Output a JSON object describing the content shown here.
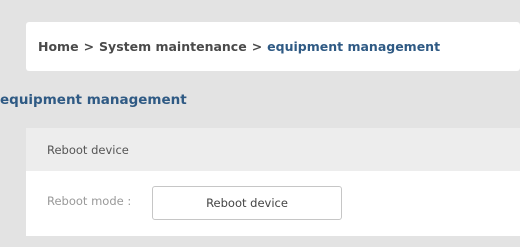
{
  "breadcrumb": {
    "home": "Home",
    "separator": ">",
    "parent": "System maintenance",
    "current": "equipment management"
  },
  "page_title": "equipment management",
  "section": {
    "title": "Reboot device",
    "reboot_mode_label": "Reboot mode :",
    "reboot_button_label": "Reboot device"
  },
  "colors": {
    "accent": "#2f5a84",
    "background": "#e3e3e3"
  }
}
